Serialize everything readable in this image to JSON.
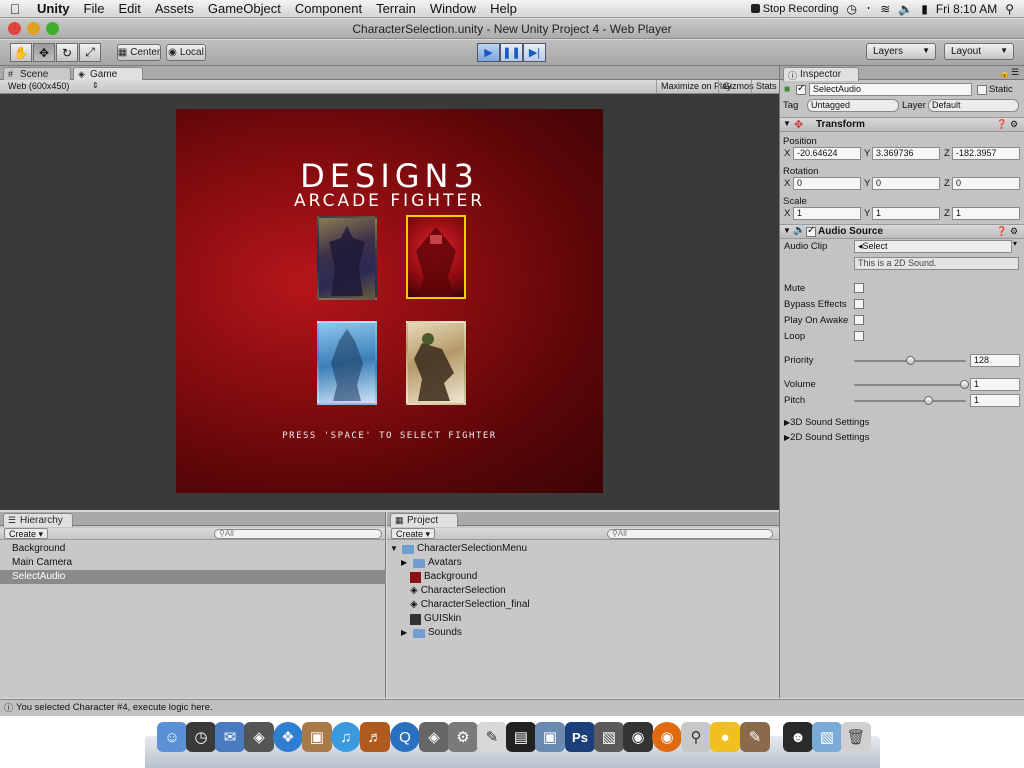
{
  "menubar": {
    "items": [
      "Unity",
      "File",
      "Edit",
      "Assets",
      "GameObject",
      "Component",
      "Terrain",
      "Window",
      "Help"
    ],
    "recording": "Stop Recording",
    "clock": "Fri 8:10 AM"
  },
  "window": {
    "title": "CharacterSelection.unity - New Unity Project 4 - Web Player"
  },
  "toolbar": {
    "pivot": "Center",
    "space": "Local",
    "layers": "Layers",
    "layout": "Layout"
  },
  "tabs": {
    "scene": "Scene",
    "game": "Game",
    "inspector": "Inspector",
    "hierarchy": "Hierarchy",
    "project": "Project"
  },
  "gamebar": {
    "resolution": "Web (600x450)",
    "maximize": "Maximize on Play",
    "gizmos": "Gizmos",
    "stats": "Stats"
  },
  "game": {
    "title": "DESIGN3",
    "subtitle": "ARCADE FIGHTER",
    "prompt": "PRESS 'SPACE' TO SELECT FIGHTER",
    "selected_index": 1
  },
  "inspector": {
    "object_name": "SelectAudio",
    "static": "Static",
    "tag_label": "Tag",
    "tag_value": "Untagged",
    "layer_label": "Layer",
    "layer_value": "Default",
    "transform": {
      "title": "Transform",
      "position_label": "Position",
      "rotation_label": "Rotation",
      "scale_label": "Scale",
      "position": {
        "x": "-20.64624",
        "y": "3.369736",
        "z": "-182.3957"
      },
      "rotation": {
        "x": "0",
        "y": "0",
        "z": "0"
      },
      "scale": {
        "x": "1",
        "y": "1",
        "z": "1"
      }
    },
    "audio": {
      "title": "Audio Source",
      "clip_label": "Audio Clip",
      "clip_value": "Select",
      "clip_note": "This is a 2D Sound.",
      "mute": "Mute",
      "bypass": "Bypass Effects",
      "play_on_awake": "Play On Awake",
      "loop": "Loop",
      "priority_label": "Priority",
      "priority": "128",
      "volume_label": "Volume",
      "volume": "1",
      "pitch_label": "Pitch",
      "pitch": "1",
      "sound3d": "3D Sound Settings",
      "sound2d": "2D Sound Settings"
    }
  },
  "hierarchy": {
    "create": "Create",
    "search": "All",
    "items": [
      "Background",
      "Main Camera",
      "SelectAudio"
    ]
  },
  "project": {
    "create": "Create",
    "search": "All",
    "root": "CharacterSelectionMenu",
    "items": [
      "Avatars",
      "Background",
      "CharacterSelection",
      "CharacterSelection_final",
      "GUISkin",
      "Sounds"
    ]
  },
  "status": "You selected Character #4, execute logic here."
}
